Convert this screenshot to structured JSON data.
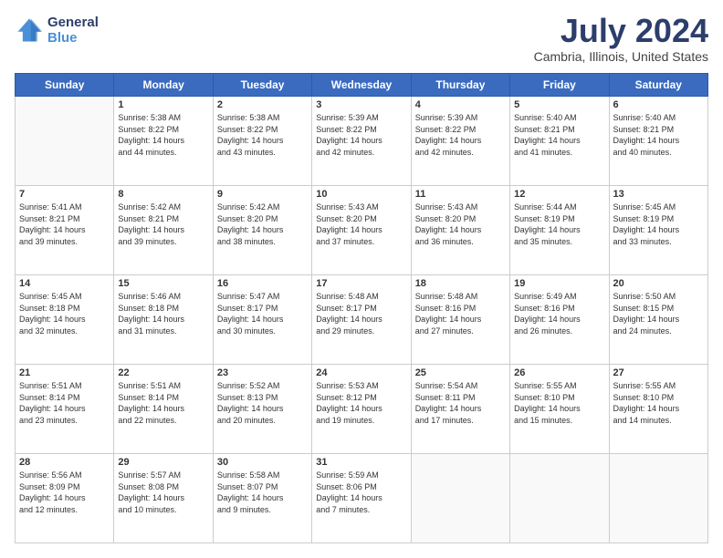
{
  "header": {
    "logo_line1": "General",
    "logo_line2": "Blue",
    "title": "July 2024",
    "subtitle": "Cambria, Illinois, United States"
  },
  "days_of_week": [
    "Sunday",
    "Monday",
    "Tuesday",
    "Wednesday",
    "Thursday",
    "Friday",
    "Saturday"
  ],
  "weeks": [
    [
      {
        "day": "",
        "info": ""
      },
      {
        "day": "1",
        "info": "Sunrise: 5:38 AM\nSunset: 8:22 PM\nDaylight: 14 hours\nand 44 minutes."
      },
      {
        "day": "2",
        "info": "Sunrise: 5:38 AM\nSunset: 8:22 PM\nDaylight: 14 hours\nand 43 minutes."
      },
      {
        "day": "3",
        "info": "Sunrise: 5:39 AM\nSunset: 8:22 PM\nDaylight: 14 hours\nand 42 minutes."
      },
      {
        "day": "4",
        "info": "Sunrise: 5:39 AM\nSunset: 8:22 PM\nDaylight: 14 hours\nand 42 minutes."
      },
      {
        "day": "5",
        "info": "Sunrise: 5:40 AM\nSunset: 8:21 PM\nDaylight: 14 hours\nand 41 minutes."
      },
      {
        "day": "6",
        "info": "Sunrise: 5:40 AM\nSunset: 8:21 PM\nDaylight: 14 hours\nand 40 minutes."
      }
    ],
    [
      {
        "day": "7",
        "info": "Sunrise: 5:41 AM\nSunset: 8:21 PM\nDaylight: 14 hours\nand 39 minutes."
      },
      {
        "day": "8",
        "info": "Sunrise: 5:42 AM\nSunset: 8:21 PM\nDaylight: 14 hours\nand 39 minutes."
      },
      {
        "day": "9",
        "info": "Sunrise: 5:42 AM\nSunset: 8:20 PM\nDaylight: 14 hours\nand 38 minutes."
      },
      {
        "day": "10",
        "info": "Sunrise: 5:43 AM\nSunset: 8:20 PM\nDaylight: 14 hours\nand 37 minutes."
      },
      {
        "day": "11",
        "info": "Sunrise: 5:43 AM\nSunset: 8:20 PM\nDaylight: 14 hours\nand 36 minutes."
      },
      {
        "day": "12",
        "info": "Sunrise: 5:44 AM\nSunset: 8:19 PM\nDaylight: 14 hours\nand 35 minutes."
      },
      {
        "day": "13",
        "info": "Sunrise: 5:45 AM\nSunset: 8:19 PM\nDaylight: 14 hours\nand 33 minutes."
      }
    ],
    [
      {
        "day": "14",
        "info": "Sunrise: 5:45 AM\nSunset: 8:18 PM\nDaylight: 14 hours\nand 32 minutes."
      },
      {
        "day": "15",
        "info": "Sunrise: 5:46 AM\nSunset: 8:18 PM\nDaylight: 14 hours\nand 31 minutes."
      },
      {
        "day": "16",
        "info": "Sunrise: 5:47 AM\nSunset: 8:17 PM\nDaylight: 14 hours\nand 30 minutes."
      },
      {
        "day": "17",
        "info": "Sunrise: 5:48 AM\nSunset: 8:17 PM\nDaylight: 14 hours\nand 29 minutes."
      },
      {
        "day": "18",
        "info": "Sunrise: 5:48 AM\nSunset: 8:16 PM\nDaylight: 14 hours\nand 27 minutes."
      },
      {
        "day": "19",
        "info": "Sunrise: 5:49 AM\nSunset: 8:16 PM\nDaylight: 14 hours\nand 26 minutes."
      },
      {
        "day": "20",
        "info": "Sunrise: 5:50 AM\nSunset: 8:15 PM\nDaylight: 14 hours\nand 24 minutes."
      }
    ],
    [
      {
        "day": "21",
        "info": "Sunrise: 5:51 AM\nSunset: 8:14 PM\nDaylight: 14 hours\nand 23 minutes."
      },
      {
        "day": "22",
        "info": "Sunrise: 5:51 AM\nSunset: 8:14 PM\nDaylight: 14 hours\nand 22 minutes."
      },
      {
        "day": "23",
        "info": "Sunrise: 5:52 AM\nSunset: 8:13 PM\nDaylight: 14 hours\nand 20 minutes."
      },
      {
        "day": "24",
        "info": "Sunrise: 5:53 AM\nSunset: 8:12 PM\nDaylight: 14 hours\nand 19 minutes."
      },
      {
        "day": "25",
        "info": "Sunrise: 5:54 AM\nSunset: 8:11 PM\nDaylight: 14 hours\nand 17 minutes."
      },
      {
        "day": "26",
        "info": "Sunrise: 5:55 AM\nSunset: 8:10 PM\nDaylight: 14 hours\nand 15 minutes."
      },
      {
        "day": "27",
        "info": "Sunrise: 5:55 AM\nSunset: 8:10 PM\nDaylight: 14 hours\nand 14 minutes."
      }
    ],
    [
      {
        "day": "28",
        "info": "Sunrise: 5:56 AM\nSunset: 8:09 PM\nDaylight: 14 hours\nand 12 minutes."
      },
      {
        "day": "29",
        "info": "Sunrise: 5:57 AM\nSunset: 8:08 PM\nDaylight: 14 hours\nand 10 minutes."
      },
      {
        "day": "30",
        "info": "Sunrise: 5:58 AM\nSunset: 8:07 PM\nDaylight: 14 hours\nand 9 minutes."
      },
      {
        "day": "31",
        "info": "Sunrise: 5:59 AM\nSunset: 8:06 PM\nDaylight: 14 hours\nand 7 minutes."
      },
      {
        "day": "",
        "info": ""
      },
      {
        "day": "",
        "info": ""
      },
      {
        "day": "",
        "info": ""
      }
    ]
  ]
}
